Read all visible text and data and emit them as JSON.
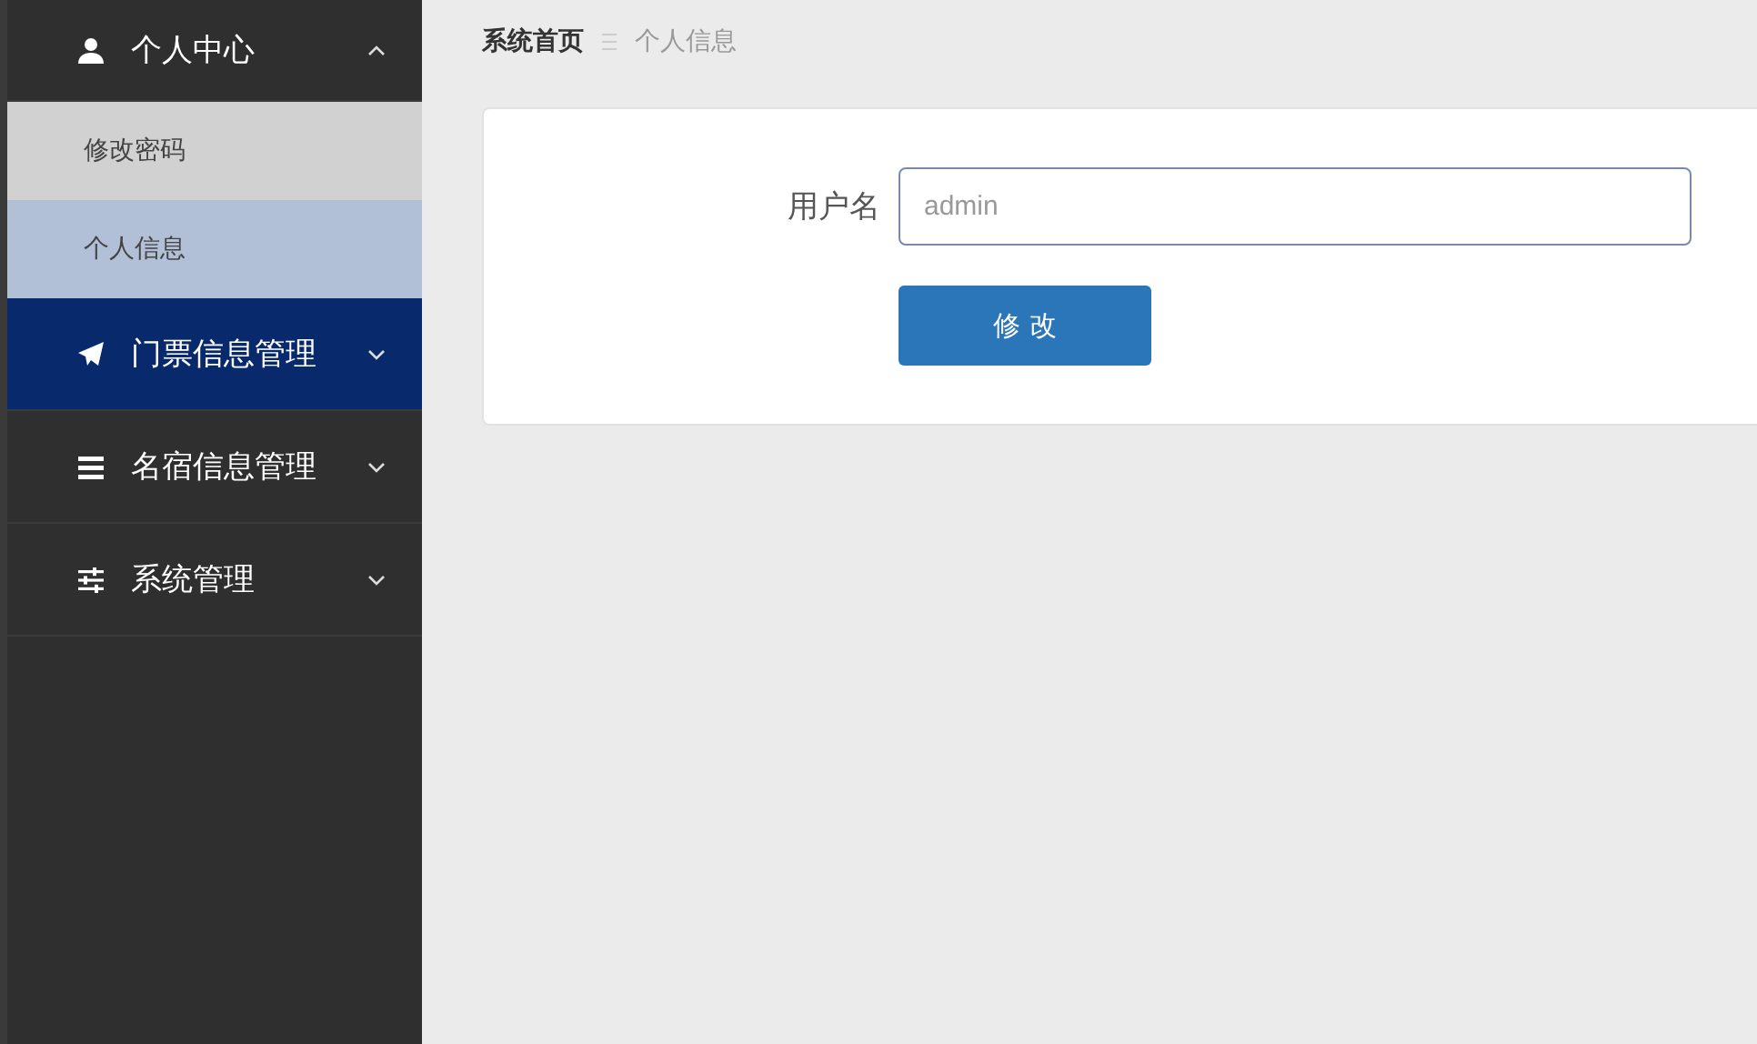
{
  "sidebar": {
    "groups": [
      {
        "label": "个人中心",
        "expanded": true,
        "highlighted": false,
        "children": [
          {
            "label": "修改密码",
            "selected": false
          },
          {
            "label": "个人信息",
            "selected": true
          }
        ]
      },
      {
        "label": "门票信息管理",
        "expanded": false,
        "highlighted": true
      },
      {
        "label": "名宿信息管理",
        "expanded": false,
        "highlighted": false
      },
      {
        "label": "系统管理",
        "expanded": false,
        "highlighted": false
      }
    ]
  },
  "breadcrumb": [
    "系统首页",
    "个人信息"
  ],
  "form": {
    "fields": [
      {
        "label": "用户名",
        "value": "admin"
      }
    ],
    "submit": "修 改"
  }
}
